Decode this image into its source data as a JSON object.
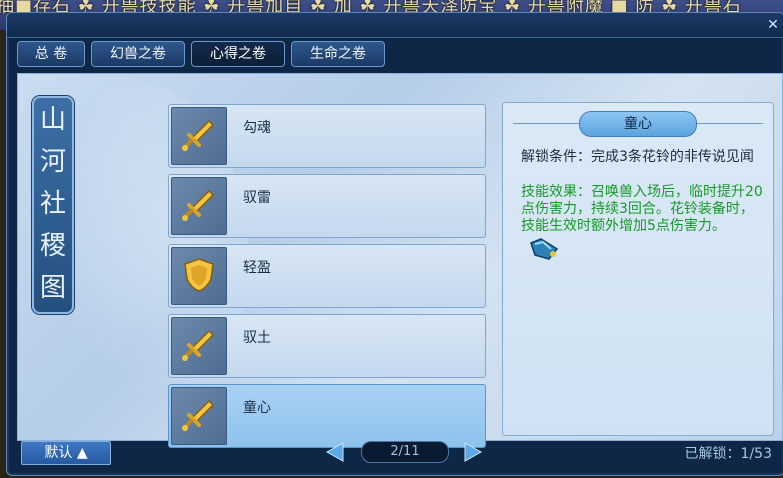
{
  "background": {
    "ticker_text": "抽■存石 ☘ 开兽技技能 ☘ 开兽加自 ☘ 加 ☘ 开兽天泽防宝 ☘ 开兽附魔 ■ 防 ☘ 开兽石"
  },
  "tabs": [
    {
      "label": "总 卷"
    },
    {
      "label": "幻兽之卷"
    },
    {
      "label": "心得之卷"
    },
    {
      "label": "生命之卷"
    }
  ],
  "scroll_title": [
    "山",
    "河",
    "社",
    "稷",
    "图"
  ],
  "list": [
    {
      "name": "勾魂",
      "icon": "sword-icon"
    },
    {
      "name": "驭雷",
      "icon": "sword-icon"
    },
    {
      "name": "轻盈",
      "icon": "shield-icon"
    },
    {
      "name": "驭土",
      "icon": "sword-icon"
    },
    {
      "name": "童心",
      "icon": "sword-icon"
    }
  ],
  "detail": {
    "title": "童心",
    "unlock_condition": "解锁条件：完成3条花铃的非传说见闻",
    "effect": "技能效果：召唤兽入场后，临时提升20点伤害力，持续3回合。花铃装备时，技能生效时额外增加5点伤害力。"
  },
  "footer": {
    "default_label": "默认 ▲",
    "page": "2/11",
    "unlocked": "已解锁：1/53"
  },
  "colors": {
    "accent": "#3f78c4",
    "effect_green": "#169a28",
    "selected_item": "#a9d2f4"
  }
}
